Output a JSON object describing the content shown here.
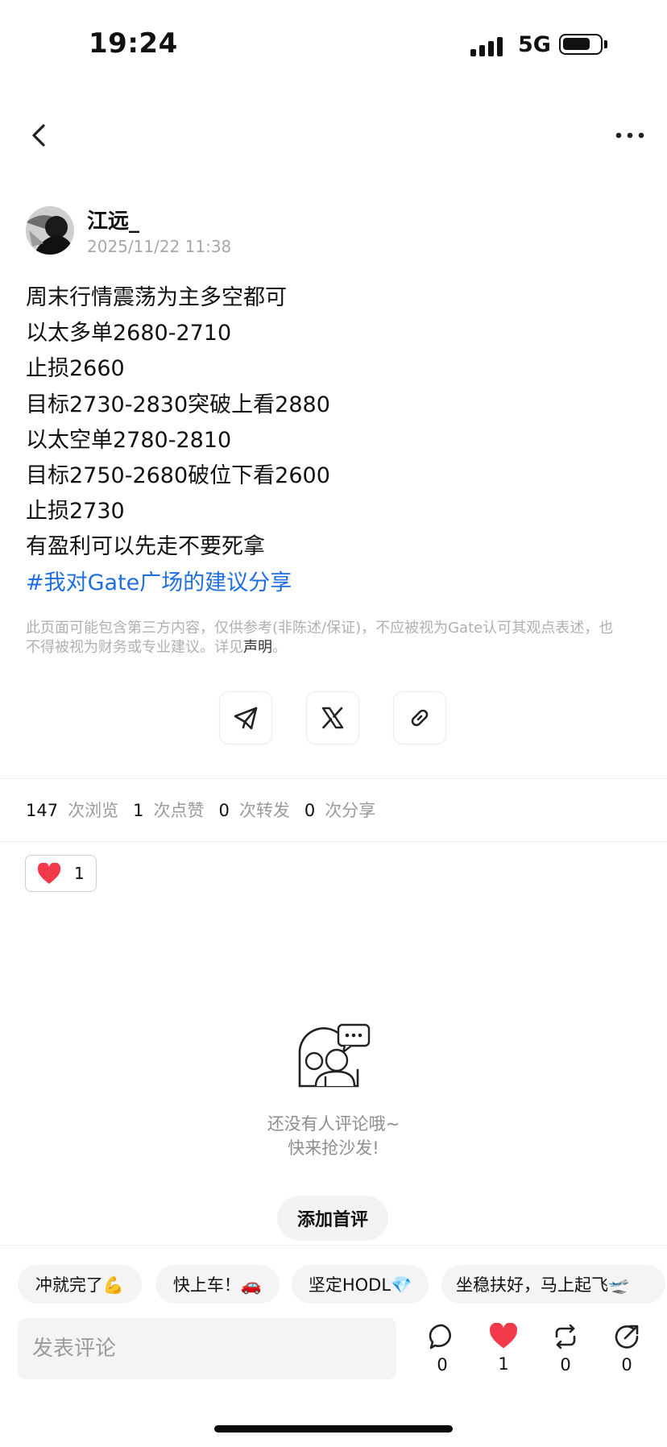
{
  "status_bar": {
    "time": "19:24",
    "network": "5G"
  },
  "post": {
    "author": "江远_",
    "timestamp": "2025/11/22 11:38",
    "lines": [
      "周末行情震荡为主多空都可",
      "以太多单2680-2710",
      "止损2660",
      "目标2730-2830突破上看2880",
      "以太空单2780-2810",
      "目标2750-2680破位下看2600",
      "止损2730",
      "有盈利可以先走不要死拿"
    ],
    "hashtag": "#我对Gate广场的建议分享",
    "disclaimer_text": "此页面可能包含第三方内容，仅供参考(非陈述/保证)，不应被视为Gate认可其观点表述，也不得被视为财务或专业建议。详见",
    "disclaimer_link": "声明",
    "disclaimer_end": "。"
  },
  "share": {
    "icons": [
      "telegram-icon",
      "x-icon",
      "link-icon"
    ]
  },
  "stats": {
    "views": "147",
    "views_label": "次浏览",
    "likes": "1",
    "likes_label": "次点赞",
    "reposts": "0",
    "reposts_label": "次转发",
    "shares": "0",
    "shares_label": "次分享"
  },
  "reaction": {
    "emoji": "heart",
    "count": "1"
  },
  "empty_state": {
    "line1": "还没有人评论哦~",
    "line2": "快来抢沙发!",
    "button": "添加首评"
  },
  "quick_replies": [
    "冲就完了💪",
    "快上车！🚗",
    "坚定HODL💎",
    "坐稳扶好，马上起飞🛫"
  ],
  "comment_box": {
    "placeholder": "发表评论"
  },
  "actions": {
    "comment_count": "0",
    "like_count": "1",
    "repost_count": "0",
    "share_count": "0"
  },
  "colors": {
    "accent_blue": "#1f6fe0",
    "heart_red": "#f2394a"
  }
}
